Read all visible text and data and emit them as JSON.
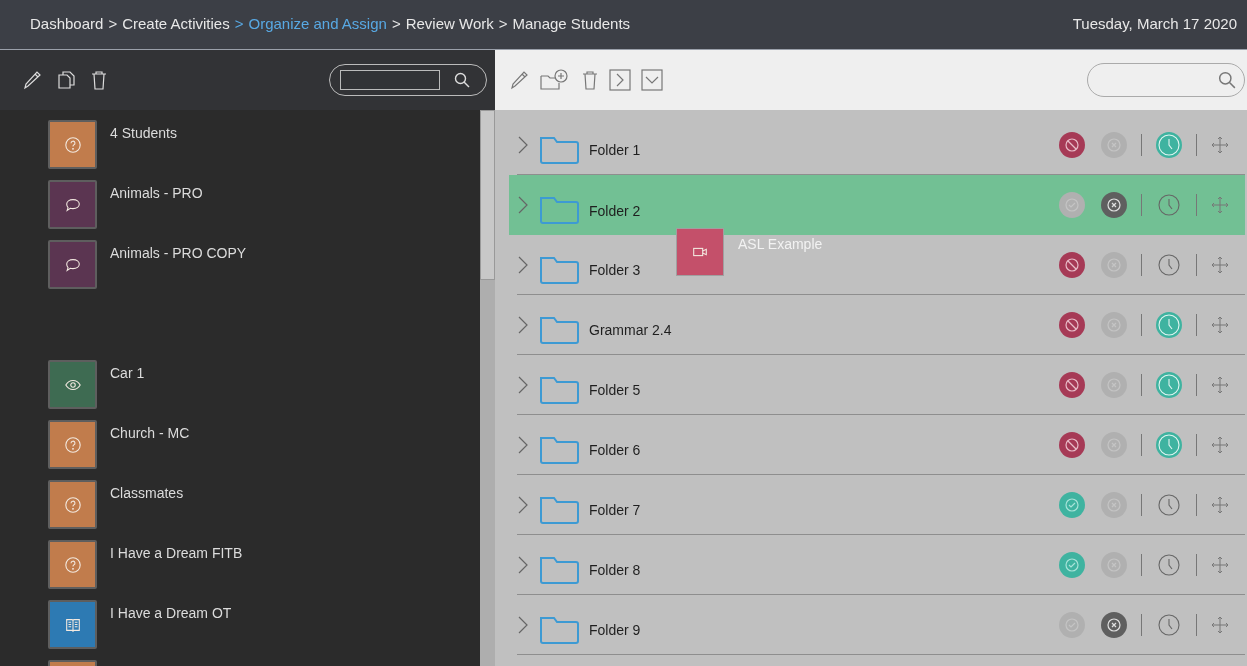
{
  "breadcrumb": {
    "separator": ">",
    "items": [
      {
        "label": "Dashboard",
        "current": false
      },
      {
        "label": "Create Activities",
        "current": false
      },
      {
        "label": "Organize and Assign",
        "current": true
      },
      {
        "label": "Review Work",
        "current": false
      },
      {
        "label": "Manage Students",
        "current": false
      }
    ],
    "date": "Tuesday, March 17 2020"
  },
  "activities": [
    {
      "kind": "quiz",
      "title": "4 Students"
    },
    {
      "kind": "discussion",
      "title": "Animals - PRO"
    },
    {
      "kind": "discussion",
      "title": "Animals - PRO COPY"
    },
    {
      "kind": "blank"
    },
    {
      "kind": "view",
      "title": "Car 1"
    },
    {
      "kind": "quiz",
      "title": "Church - MC"
    },
    {
      "kind": "quiz",
      "title": "Classmates"
    },
    {
      "kind": "quiz",
      "title": "I Have a Dream FITB"
    },
    {
      "kind": "reading",
      "title": "I Have a Dream OT"
    },
    {
      "kind": "quiz"
    }
  ],
  "folders": [
    {
      "name": "Folder 1",
      "selected": false,
      "status": {
        "kind": "blocked"
      },
      "hidden": false,
      "scheduled": true
    },
    {
      "name": "Folder 2",
      "selected": true,
      "status": {
        "kind": "unpublished"
      },
      "hidden": true,
      "scheduled": false
    },
    {
      "name": "Folder 3",
      "selected": false,
      "status": {
        "kind": "blocked"
      },
      "hidden": false,
      "scheduled": false
    },
    {
      "name": "Grammar 2.4",
      "selected": false,
      "status": {
        "kind": "blocked"
      },
      "hidden": false,
      "scheduled": true
    },
    {
      "name": "Folder 5",
      "selected": false,
      "status": {
        "kind": "blocked"
      },
      "hidden": false,
      "scheduled": true
    },
    {
      "name": "Folder 6",
      "selected": false,
      "status": {
        "kind": "blocked"
      },
      "hidden": false,
      "scheduled": true
    },
    {
      "name": "Folder 7",
      "selected": false,
      "status": {
        "kind": "published"
      },
      "hidden": false,
      "scheduled": false
    },
    {
      "name": "Folder 8",
      "selected": false,
      "status": {
        "kind": "published"
      },
      "hidden": false,
      "scheduled": false
    },
    {
      "name": "Folder 9",
      "selected": false,
      "status": {
        "kind": "unpublished"
      },
      "hidden": true,
      "scheduled": false
    }
  ],
  "dragged": {
    "kind": "video",
    "title": "ASL Example"
  }
}
